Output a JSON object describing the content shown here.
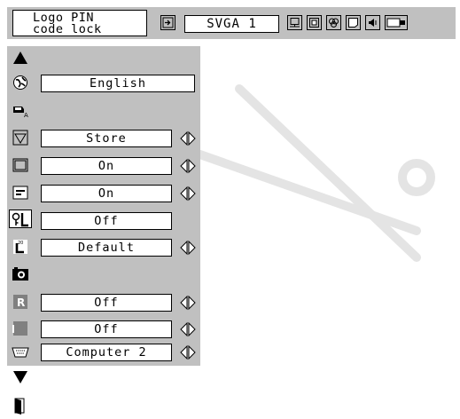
{
  "toolbar": {
    "title_line1": "Logo PIN",
    "title_line2": "code lock",
    "signal": "SVGA 1"
  },
  "menu": {
    "language": "English",
    "rows": [
      {
        "value": "Store",
        "arrows": true
      },
      {
        "value": "On",
        "arrows": true
      },
      {
        "value": "On",
        "arrows": true
      },
      {
        "value": "Off",
        "arrows": false
      },
      {
        "value": "Default",
        "arrows": true
      },
      {
        "value": "Off",
        "arrows": true
      },
      {
        "value": "Off",
        "arrows": true
      },
      {
        "value": "Computer 2",
        "arrows": true
      }
    ]
  },
  "icons": {
    "scroll_up": "up-triangle-icon",
    "scroll_down": "down-triangle-icon",
    "exit": "exit-door-icon"
  },
  "colors": {
    "panel": "#c0c0c0",
    "field": "#ffffff",
    "border": "#000000"
  }
}
